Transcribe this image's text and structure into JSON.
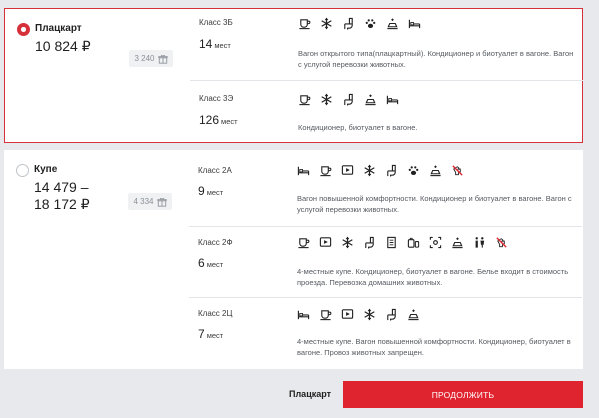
{
  "colors": {
    "accent": "#e0242f",
    "selected_border": "#d6303b"
  },
  "categories": [
    {
      "name": "Плацкарт",
      "selected": true,
      "price": "10 824 ₽",
      "bonus": "3 240",
      "cars": [
        {
          "class_label": "Класс 3Б",
          "seats_count": "14",
          "seats_unit": "мест",
          "amenities": [
            "food-icon",
            "snowflake-icon",
            "wc-icon",
            "paw-icon",
            "linen-icon",
            "bed-icon"
          ],
          "description": "Вагон открытого типа(плацкартный). Кондиционер и биотуалет в вагоне. Вагон с услугой перевозки животных."
        },
        {
          "class_label": "Класс 3Э",
          "seats_count": "126",
          "seats_unit": "мест",
          "amenities": [
            "food-icon",
            "snowflake-icon",
            "wc-icon",
            "linen-icon",
            "bed-icon"
          ],
          "description": "Кондиционер, биотуалет в вагоне."
        }
      ]
    },
    {
      "name": "Купе",
      "selected": false,
      "price_line1": "14 479 –",
      "price_line2": "18 172 ₽",
      "bonus": "4 334",
      "cars": [
        {
          "class_label": "Класс 2А",
          "seats_count": "9",
          "seats_unit": "мест",
          "amenities": [
            "bed-icon",
            "food-icon",
            "tv-icon",
            "snowflake-icon",
            "wc-icon",
            "paw-icon",
            "linen-icon",
            "no-pets-icon"
          ],
          "description": "Вагон повышенной комфортности. Кондиционер и биотуалет в вагоне. Вагон с услугой перевозки животных."
        },
        {
          "class_label": "Класс 2Ф",
          "seats_count": "6",
          "seats_unit": "мест",
          "amenities": [
            "food-icon",
            "tv-icon",
            "snowflake-icon",
            "wc-icon",
            "press-icon",
            "hygiene-icon",
            "shower-icon",
            "linen-icon",
            "toilets-icon",
            "no-pets-icon"
          ],
          "description": "4-местные купе. Кондиционер, биотуалет в вагоне. Белье входит в стоимость проезда. Перевозка домашних животных."
        },
        {
          "class_label": "Класс 2Ц",
          "seats_count": "7",
          "seats_unit": "мест",
          "amenities": [
            "bed-icon",
            "food-icon",
            "tv-icon",
            "snowflake-icon",
            "wc-icon",
            "linen-icon"
          ],
          "description": "4-местные купе. Вагон повышенной комфортности. Кондиционер, биотуалет в вагоне. Провоз животных запрещен."
        }
      ]
    }
  ],
  "footer": {
    "selected_category": "Плацкарт",
    "continue_label": "ПРОДОЛЖИТЬ"
  }
}
